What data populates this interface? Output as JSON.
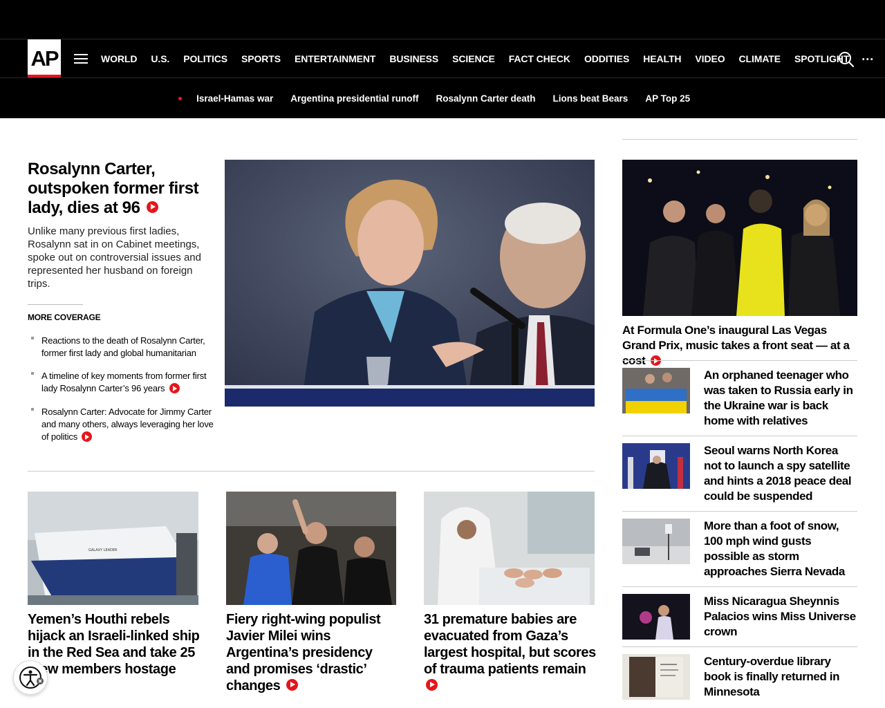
{
  "header": {
    "logo_text": "AP",
    "nav": [
      "WORLD",
      "U.S.",
      "POLITICS",
      "SPORTS",
      "ENTERTAINMENT",
      "BUSINESS",
      "SCIENCE",
      "FACT CHECK",
      "ODDITIES",
      "HEALTH",
      "VIDEO",
      "CLIMATE",
      "SPOTLIGHT"
    ],
    "more": "..."
  },
  "trending": [
    "Israel-Hamas war",
    "Argentina presidential runoff",
    "Rosalynn Carter death",
    "Lions beat Bears",
    "AP Top 25"
  ],
  "lead": {
    "title": "Rosalynn Carter, outspoken former first lady, dies at 96",
    "description": "Unlike many previous first ladies, Rosalynn sat in on Cabinet meetings, spoke out on controversial issues and represented her husband on foreign trips.",
    "more_coverage_label": "MORE COVERAGE",
    "coverage": [
      "Reactions to the death of Rosalynn Carter, former first lady and global humanitarian",
      "A timeline of key moments from former first lady Rosalynn Carter’s 96 years",
      "Rosalynn Carter: Advocate for Jimmy Carter and many others, always leveraging her love of politics"
    ]
  },
  "cards": [
    "Yemen’s Houthi rebels hijack an Israeli-linked ship in the Red Sea and take 25 crew members hostage",
    "Fiery right-wing populist Javier Milei wins Argentina’s presidency and promises ‘drastic’ changes",
    "31 premature babies are evacuated from Gaza’s largest hospital, but scores of trauma patients remain"
  ],
  "sidebar": {
    "feature_title": "At Formula One’s inaugural Las Vegas Grand Prix, music takes a front seat — at a cost",
    "items": [
      "An orphaned teenager who was taken to Russia early in the Ukraine war is back home with relatives",
      "Seoul warns North Korea not to launch a spy satellite and hints a 2018 peace deal could be suspended",
      "More than a foot of snow, 100 mph wind gusts possible as storm approaches Sierra Nevada",
      "Miss Nicaragua Sheynnis Palacios wins Miss Universe crown",
      "Century-overdue library book is finally returned in Minnesota"
    ]
  },
  "ship_text": "GALAXY LEADER",
  "colors": {
    "brand_red": "#e5161b",
    "header_bg": "#000000"
  }
}
